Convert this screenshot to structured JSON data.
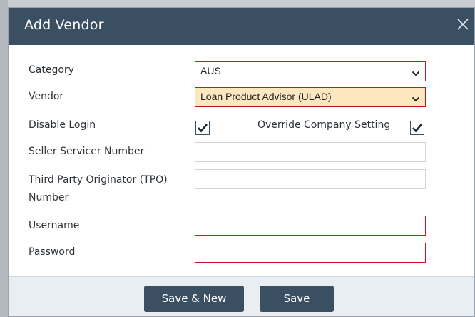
{
  "dialog": {
    "title": "Add Vendor",
    "fields": {
      "category": {
        "label": "Category",
        "value": "AUS"
      },
      "vendor": {
        "label": "Vendor",
        "value": "Loan Product Advisor (ULAD)"
      },
      "disable_login": {
        "label": "Disable Login",
        "checked": true
      },
      "override_company_setting": {
        "label": "Override Company Setting",
        "checked": true
      },
      "seller_servicer_number": {
        "label": "Seller Servicer Number",
        "value": ""
      },
      "tpo_number": {
        "label_line1": "Third Party Originator (TPO)",
        "label_line2": "Number",
        "value": ""
      },
      "username": {
        "label": "Username",
        "value": ""
      },
      "password": {
        "label": "Password",
        "value": ""
      }
    },
    "buttons": {
      "save_new": "Save & New",
      "save": "Save"
    }
  },
  "colors": {
    "header_bg": "#3b4f63",
    "required_border": "#c8171e",
    "highlight_bg": "#fde7bf",
    "footer_bg": "#e9eef3"
  }
}
